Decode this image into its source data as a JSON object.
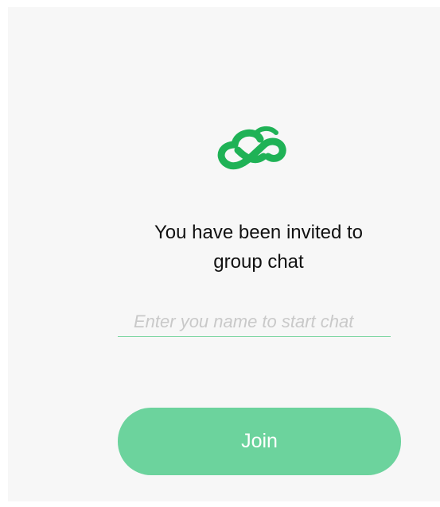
{
  "invite": {
    "title_line1": "You have been invited to",
    "title_line2": "group chat",
    "name_placeholder": "Enter you name to start chat",
    "name_value": "",
    "join_label": "Join"
  },
  "icons": {
    "logo": "cloud-infinity-logo-icon"
  },
  "colors": {
    "brand_green": "#1fb256",
    "button_green": "#6cd39d",
    "underline_green": "#7fd7a3",
    "panel_bg": "#f7f7f7"
  }
}
